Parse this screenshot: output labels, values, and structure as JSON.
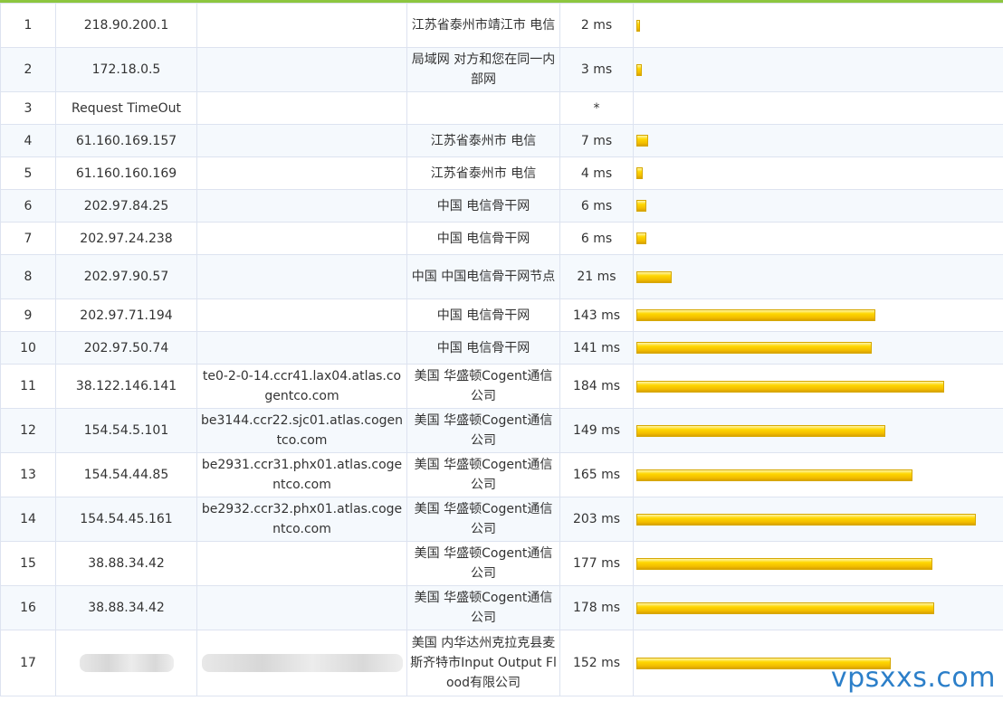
{
  "hops": [
    {
      "hop": "1",
      "ip": "218.90.200.1",
      "host": "",
      "location": "江苏省泰州市靖江市 电信",
      "time": "2 ms",
      "ms": 2
    },
    {
      "hop": "2",
      "ip": "172.18.0.5",
      "host": "",
      "location": "局域网 对方和您在同一内部网",
      "time": "3 ms",
      "ms": 3
    },
    {
      "hop": "3",
      "ip": "Request TimeOut",
      "host": "",
      "location": "",
      "time": "*",
      "ms": 0
    },
    {
      "hop": "4",
      "ip": "61.160.169.157",
      "host": "",
      "location": "江苏省泰州市 电信",
      "time": "7 ms",
      "ms": 7
    },
    {
      "hop": "5",
      "ip": "61.160.160.169",
      "host": "",
      "location": "江苏省泰州市 电信",
      "time": "4 ms",
      "ms": 4
    },
    {
      "hop": "6",
      "ip": "202.97.84.25",
      "host": "",
      "location": "中国 电信骨干网",
      "time": "6 ms",
      "ms": 6
    },
    {
      "hop": "7",
      "ip": "202.97.24.238",
      "host": "",
      "location": "中国 电信骨干网",
      "time": "6 ms",
      "ms": 6
    },
    {
      "hop": "8",
      "ip": "202.97.90.57",
      "host": "",
      "location": "中国 中国电信骨干网节点",
      "time": "21 ms",
      "ms": 21
    },
    {
      "hop": "9",
      "ip": "202.97.71.194",
      "host": "",
      "location": "中国 电信骨干网",
      "time": "143 ms",
      "ms": 143
    },
    {
      "hop": "10",
      "ip": "202.97.50.74",
      "host": "",
      "location": "中国 电信骨干网",
      "time": "141 ms",
      "ms": 141
    },
    {
      "hop": "11",
      "ip": "38.122.146.141",
      "host": "te0-2-0-14.ccr41.lax04.atlas.cogentco.com",
      "location": "美国 华盛顿Cogent通信公司",
      "time": "184 ms",
      "ms": 184
    },
    {
      "hop": "12",
      "ip": "154.54.5.101",
      "host": "be3144.ccr22.sjc01.atlas.cogentco.com",
      "location": "美国 华盛顿Cogent通信公司",
      "time": "149 ms",
      "ms": 149
    },
    {
      "hop": "13",
      "ip": "154.54.44.85",
      "host": "be2931.ccr31.phx01.atlas.cogentco.com",
      "location": "美国 华盛顿Cogent通信公司",
      "time": "165 ms",
      "ms": 165
    },
    {
      "hop": "14",
      "ip": "154.54.45.161",
      "host": "be2932.ccr32.phx01.atlas.cogentco.com",
      "location": "美国 华盛顿Cogent通信公司",
      "time": "203 ms",
      "ms": 203
    },
    {
      "hop": "15",
      "ip": "38.88.34.42",
      "host": "",
      "location": "美国 华盛顿Cogent通信公司",
      "time": "177 ms",
      "ms": 177
    },
    {
      "hop": "16",
      "ip": "38.88.34.42",
      "host": "",
      "location": "美国 华盛顿Cogent通信公司",
      "time": "178 ms",
      "ms": 178
    },
    {
      "hop": "17",
      "ip": "",
      "host": "",
      "location": "美国 内华达州克拉克县麦斯齐特市Input Output Flood有限公司",
      "time": "152 ms",
      "ms": 152,
      "redacted": true
    }
  ],
  "bar_max_ms": 203,
  "colors": {
    "accent_line": "#8dc63f",
    "bar": "#ffd700",
    "watermark": "#2c7fc9"
  },
  "watermark": "vpsxxs.com"
}
